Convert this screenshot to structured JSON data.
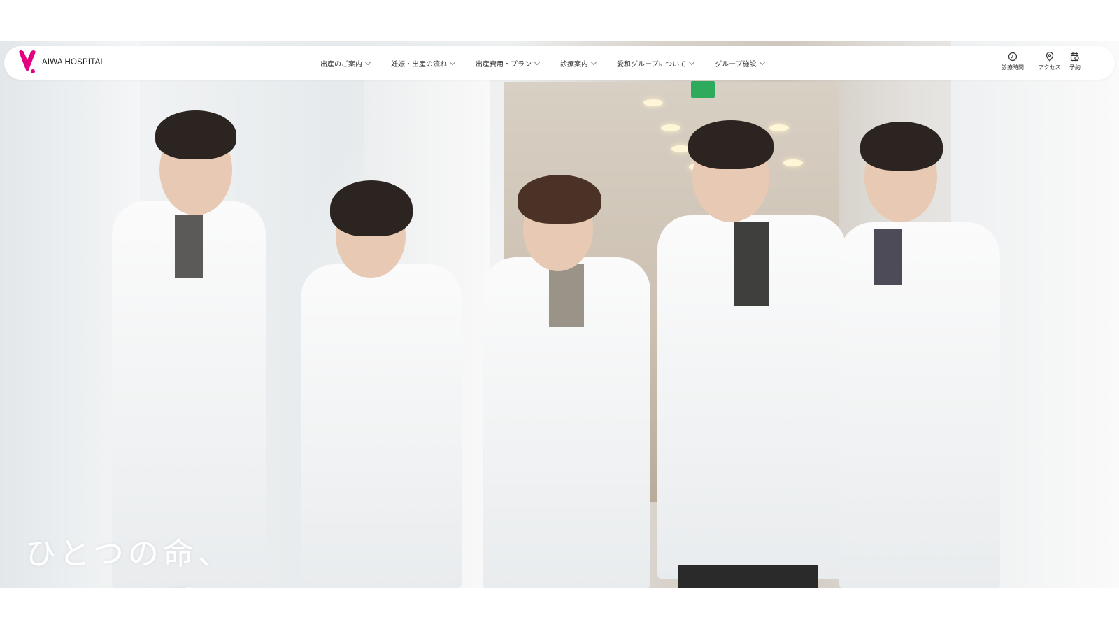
{
  "brand": {
    "name": "AIWA HOSPITAL",
    "logo_color": "#e4007f"
  },
  "nav": {
    "items": [
      {
        "label": "出産のご案内"
      },
      {
        "label": "妊娠・出産の流れ"
      },
      {
        "label": "出産費用・プラン"
      },
      {
        "label": "診療案内"
      },
      {
        "label": "愛和グループについて"
      },
      {
        "label": "グループ施設"
      }
    ],
    "utilities": [
      {
        "label": "診療時間",
        "icon": "clock-icon"
      },
      {
        "label": "アクセス",
        "icon": "map-pin-icon"
      },
      {
        "label": "予約",
        "icon": "calendar-icon"
      }
    ]
  },
  "hero": {
    "line1": "ひとつの命、",
    "line2": "あふれる愛。"
  }
}
